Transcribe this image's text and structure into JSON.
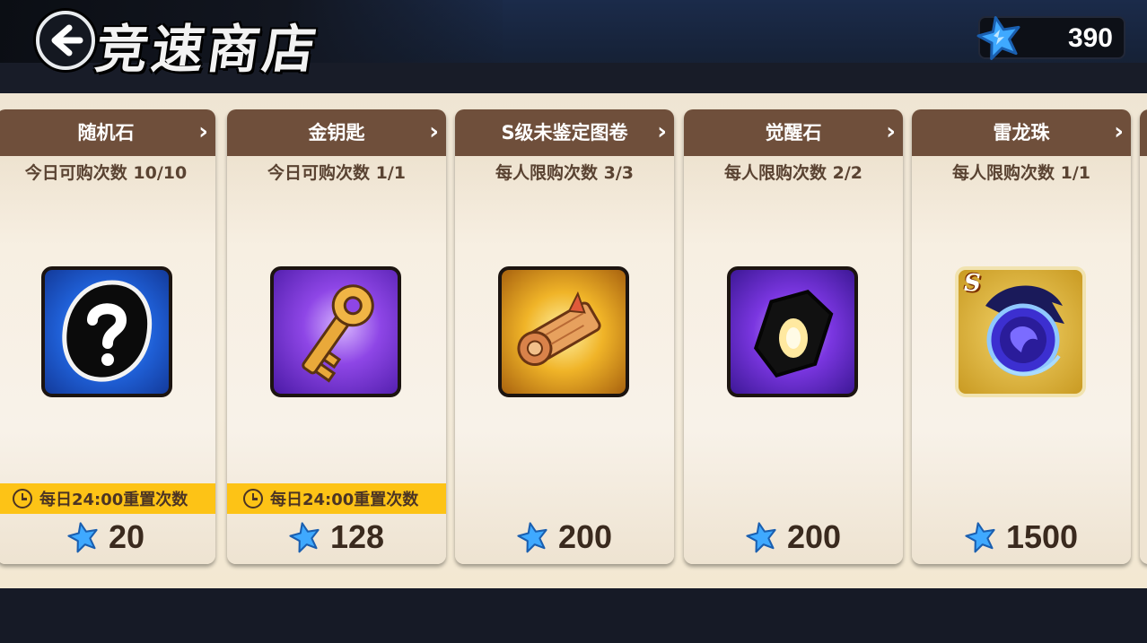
{
  "header": {
    "title": "竞速商店",
    "currency": {
      "icon": "blue-star-icon",
      "amount": "390"
    }
  },
  "colors": {
    "title_bar": "#6f4f3b",
    "reset_banner": "#fdc316",
    "currency_star": "#3fa9ff"
  },
  "items": [
    {
      "name": "随机石",
      "limit": "今日可购次数 10/10",
      "icon": "mystery-stone-icon",
      "reset": "每日24:00重置次数",
      "price": "20"
    },
    {
      "name": "金钥匙",
      "limit": "今日可购次数 1/1",
      "icon": "golden-key-icon",
      "reset": "每日24:00重置次数",
      "price": "128"
    },
    {
      "name": "S级未鉴定图卷",
      "limit": "每人限购次数 3/3",
      "icon": "scroll-icon",
      "price": "200"
    },
    {
      "name": "觉醒石",
      "limit": "每人限购次数 2/2",
      "icon": "awakening-stone-icon",
      "price": "200"
    },
    {
      "name": "雷龙珠",
      "limit": "每人限购次数 1/1",
      "icon": "thunder-dragon-orb-icon",
      "badge": "S",
      "price": "1500"
    }
  ]
}
